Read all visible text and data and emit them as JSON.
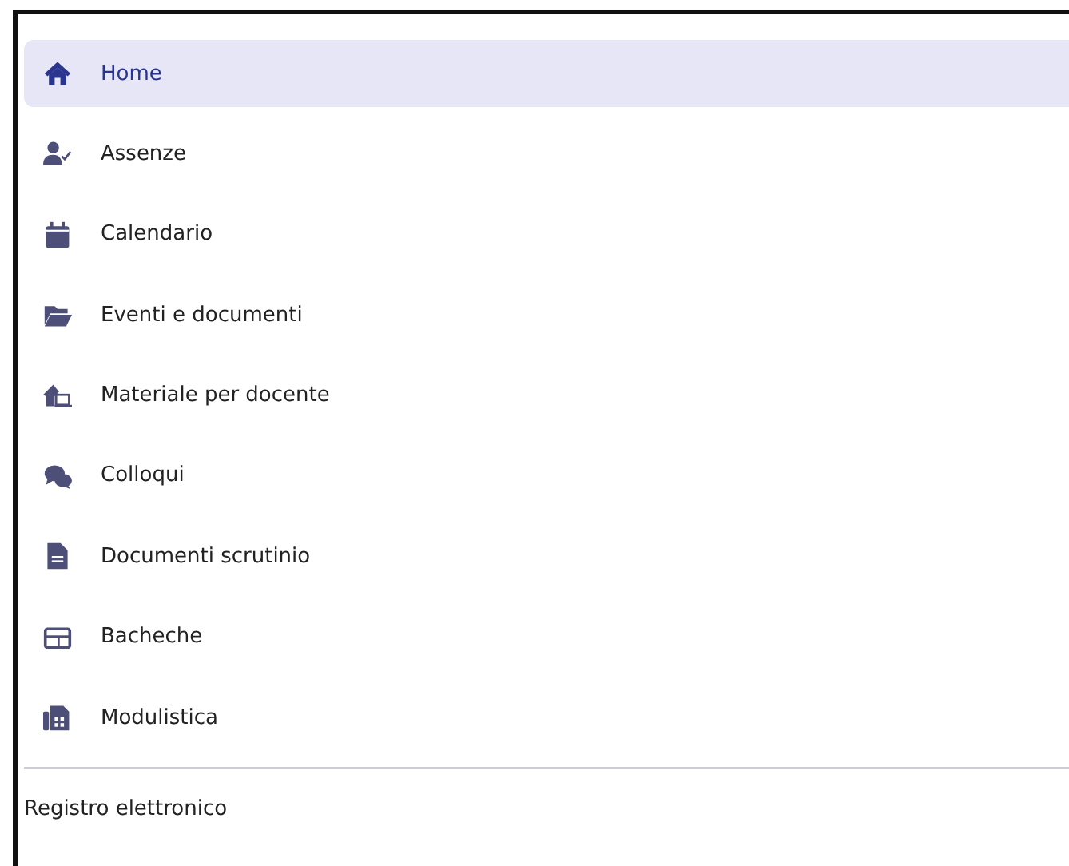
{
  "menu": {
    "items": [
      {
        "label": "Home",
        "selected": true
      },
      {
        "label": "Assenze",
        "selected": false
      },
      {
        "label": "Calendario",
        "selected": false
      },
      {
        "label": "Eventi e documenti",
        "selected": false
      },
      {
        "label": "Materiale per docente",
        "selected": false
      },
      {
        "label": "Colloqui",
        "selected": false
      },
      {
        "label": "Documenti scrutinio",
        "selected": false
      },
      {
        "label": "Bacheche",
        "selected": false
      },
      {
        "label": "Modulistica",
        "selected": false
      }
    ]
  },
  "footer": {
    "label": "Registro elettronico"
  }
}
